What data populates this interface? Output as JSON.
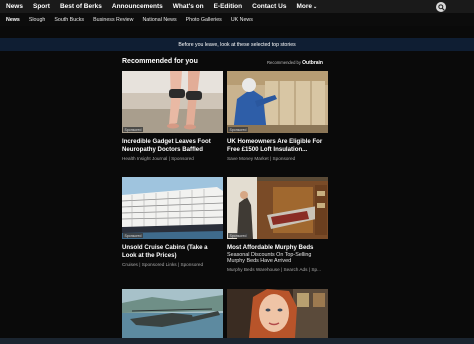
{
  "topnav": {
    "items": [
      "News",
      "Sport",
      "Best of Berks",
      "Announcements",
      "What's on",
      "E-Edition",
      "Contact Us",
      "More"
    ]
  },
  "subnav": {
    "items": [
      "News",
      "Slough",
      "South Bucks",
      "Business Review",
      "National News",
      "Photo Galleries",
      "UK News"
    ]
  },
  "banner": {
    "text": "Before you leave, look at these selected top stories"
  },
  "recommended": {
    "heading": "Recommended for you",
    "by_prefix": "Recommended by",
    "by_brand": "Outbrain",
    "badge": "Sponsored",
    "cards": [
      {
        "title": "Incredible Gadget Leaves Foot Neuropathy Doctors Baffled",
        "desc": "",
        "source": "Health Insight Journal | Sponsored",
        "image": "feet-massager-photo"
      },
      {
        "title": "UK Homeowners Are Eligible For Free £1500 Loft Insulation...",
        "desc": "",
        "source": "Save Money Market | Sponsored",
        "image": "loft-insulation-photo"
      },
      {
        "title": "Unsold Cruise Cabins (Take a Look at the Prices)",
        "desc": "",
        "source": "Cruises | Sponsored Links | Sponsored",
        "image": "cruise-ship-photo"
      },
      {
        "title": "Most Affordable Murphy Beds",
        "desc": "Seasonal Discounts On Top-Selling Murphy Beds Have Arrived",
        "source": "Murphy Beds Warehouse | Search Ads | Sp...",
        "image": "murphy-bed-photo"
      },
      {
        "title": "",
        "desc": "",
        "source": "",
        "image": "helicopter-photo"
      },
      {
        "title": "",
        "desc": "",
        "source": "",
        "image": "woman-portrait-photo"
      }
    ]
  }
}
